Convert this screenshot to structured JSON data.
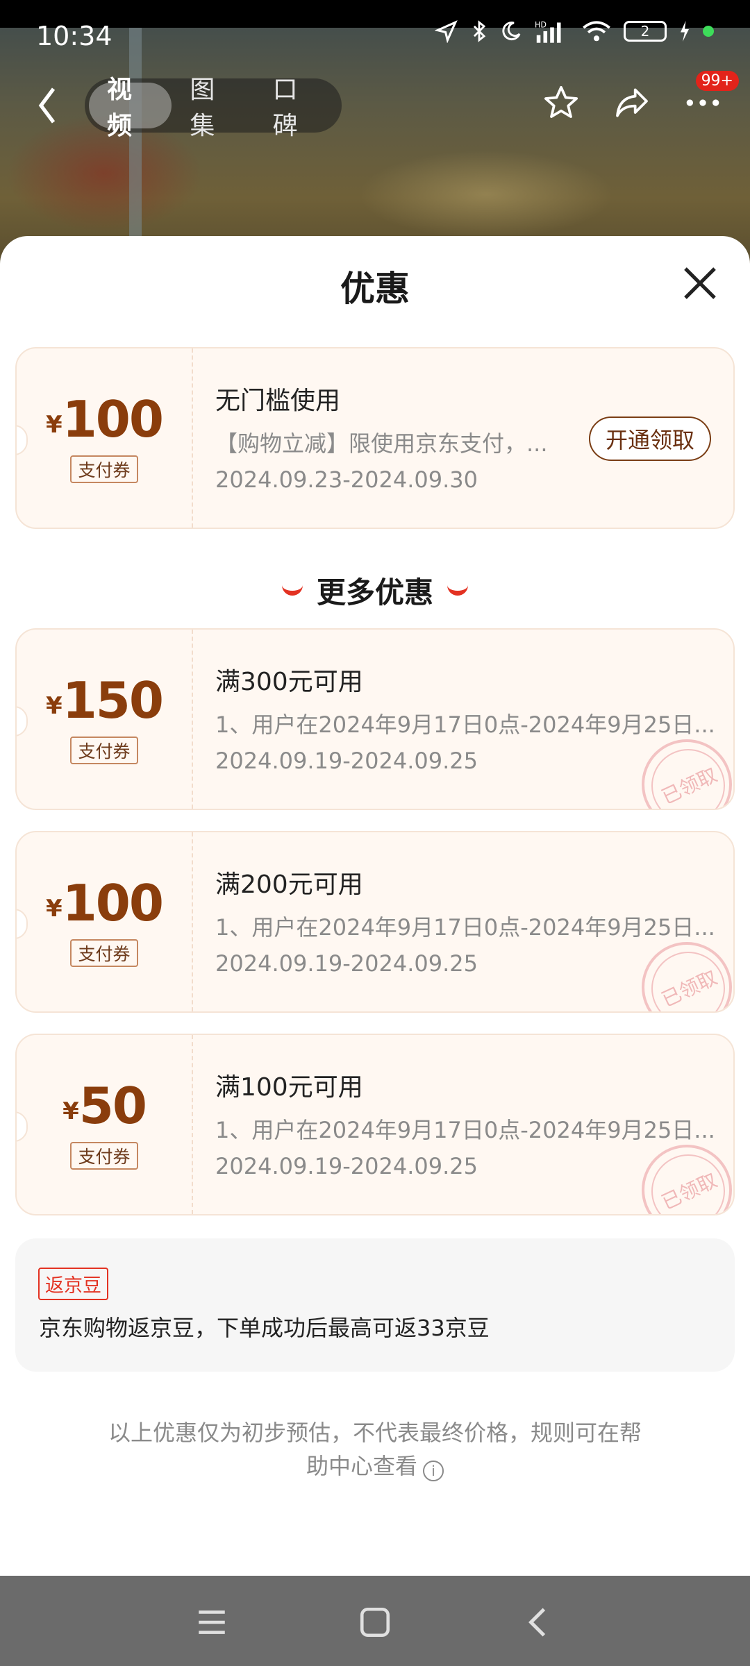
{
  "status_bar": {
    "time": "10:34",
    "battery_level": "2"
  },
  "top_nav": {
    "tabs": [
      {
        "label": "视频",
        "active": true
      },
      {
        "label": "图集",
        "active": false
      },
      {
        "label": "口碑",
        "active": false
      }
    ],
    "message_badge": "99+"
  },
  "sheet": {
    "title": "优惠",
    "primary_coupon": {
      "currency": "¥",
      "amount": "100",
      "tag": "支付券",
      "title": "无门槛使用",
      "description": "【购物立减】限使用京东支付，...",
      "date_range": "2024.09.23-2024.09.30",
      "action_label": "开通领取"
    },
    "more_header": "更多优惠",
    "more_coupons": [
      {
        "currency": "¥",
        "amount": "150",
        "tag": "支付券",
        "title": "满300元可用",
        "description": "1、用户在2024年9月17日0点-2024年9月25日...",
        "date_range": "2024.09.19-2024.09.25",
        "stamp": "已领取"
      },
      {
        "currency": "¥",
        "amount": "100",
        "tag": "支付券",
        "title": "满200元可用",
        "description": "1、用户在2024年9月17日0点-2024年9月25日...",
        "date_range": "2024.09.19-2024.09.25",
        "stamp": "已领取"
      },
      {
        "currency": "¥",
        "amount": "50",
        "tag": "支付券",
        "title": "满100元可用",
        "description": "1、用户在2024年9月17日0点-2024年9月25日...",
        "date_range": "2024.09.19-2024.09.25",
        "stamp": "已领取"
      }
    ],
    "jd_beans": {
      "tag": "返京豆",
      "text": "京东购物返京豆，下单成功后最高可返33京豆"
    },
    "footnote_line1": "以上优惠仅为初步预估，不代表最终价格，规则可在帮",
    "footnote_line2": "助中心查看"
  },
  "colors": {
    "accent_red": "#e33222",
    "coupon_brown": "#8a3d0c",
    "coupon_bg": "#fff8f2"
  }
}
